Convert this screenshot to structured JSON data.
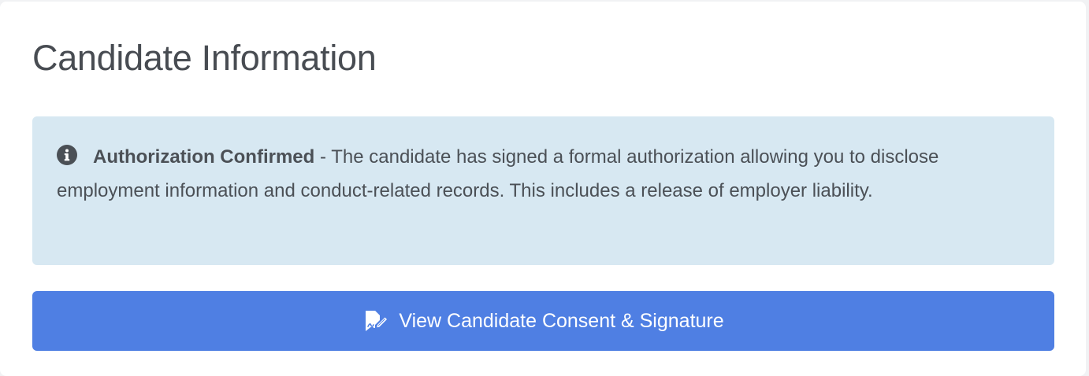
{
  "card": {
    "title": "Candidate Information"
  },
  "alert": {
    "icon": "info-circle-icon",
    "heading": "Authorization Confirmed",
    "separator": " - ",
    "body": "The candidate has signed a formal authorization allowing you to disclose employment information and conduct-related records. This includes a release of employer liability."
  },
  "action_button": {
    "icon": "file-signature-icon",
    "label": "View Candidate Consent & Signature"
  },
  "colors": {
    "alert_background": "#d7e8f2",
    "button_background": "#4f7fe3",
    "title_text": "#484c52"
  }
}
